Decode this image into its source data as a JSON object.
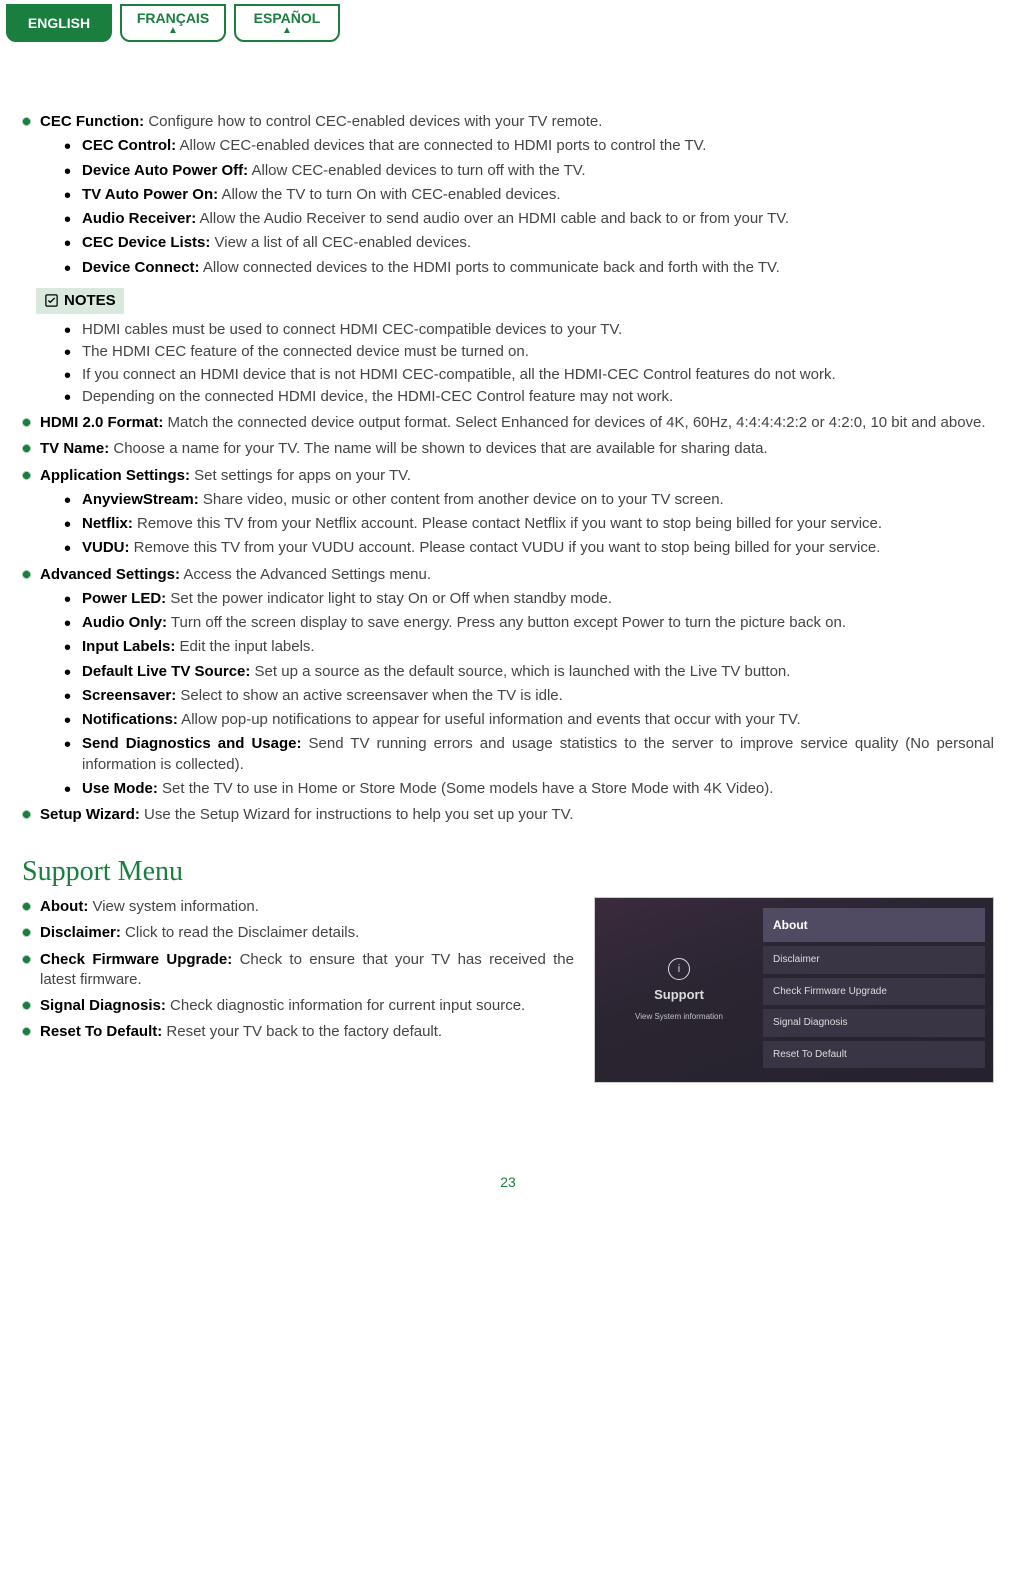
{
  "tabs": {
    "english": "ENGLISH",
    "francais": "FRANÇAIS",
    "espanol": "ESPAÑOL"
  },
  "sections": {
    "cec": {
      "title": "CEC Function:",
      "desc": " Configure how to control CEC-enabled devices with your TV remote.",
      "sub": [
        {
          "t": "CEC Control:",
          "d": " Allow CEC-enabled devices that are connected to HDMI ports to control the TV."
        },
        {
          "t": "Device Auto Power Off:",
          "d": " Allow CEC-enabled devices to turn off with the TV."
        },
        {
          "t": "TV Auto Power On:",
          "d": " Allow the TV to turn On with CEC-enabled devices."
        },
        {
          "t": "Audio Receiver:",
          "d": " Allow the Audio Receiver to send audio over an HDMI cable and back to or from your TV."
        },
        {
          "t": "CEC Device Lists:",
          "d": " View a list of all CEC-enabled devices."
        },
        {
          "t": "Device Connect:",
          "d": " Allow connected devices to the HDMI ports to communicate back and forth with the TV."
        }
      ]
    },
    "notes_label": "NOTES",
    "notes": [
      "HDMI cables must be used to connect HDMI CEC-compatible devices to your TV.",
      "The HDMI CEC feature of the connected device must be turned on.",
      "If you connect an HDMI device that is not HDMI CEC-compatible, all the HDMI-CEC Control features do not work.",
      "Depending on the connected HDMI device, the HDMI-CEC Control feature may not work."
    ],
    "hdmi20": {
      "title": "HDMI 2.0 Format:",
      "desc": " Match the connected device output format. Select Enhanced for devices of 4K, 60Hz, 4:4:4:4:2:2 or 4:2:0, 10 bit and above."
    },
    "tvname": {
      "title": "TV Name:",
      "desc": " Choose a name for your TV. The name will be shown to devices that are available for sharing data."
    },
    "apps": {
      "title": "Application Settings:",
      "desc": " Set settings for apps on your TV.",
      "sub": [
        {
          "t": "AnyviewStream:",
          "d": " Share video, music or other content from another device on to your TV screen."
        },
        {
          "t": "Netflix:",
          "d": " Remove this TV from your Netflix account. Please contact Netflix if you want to stop being billed for your service."
        },
        {
          "t": "VUDU:",
          "d": " Remove this TV from your VUDU account. Please contact VUDU if you want to stop being billed for your service."
        }
      ]
    },
    "adv": {
      "title": "Advanced Settings:",
      "desc": " Access the Advanced Settings menu.",
      "sub": [
        {
          "t": "Power LED:",
          "d": " Set the power indicator light to stay On or Off when standby mode."
        },
        {
          "t": "Audio Only:",
          "d": " Turn off the screen display to save energy. Press any button except Power to turn the picture back on."
        },
        {
          "t": "Input Labels:",
          "d": " Edit the input labels."
        },
        {
          "t": "Default Live TV Source:",
          "d": " Set up a source as the default source, which is launched with the Live TV button."
        },
        {
          "t": "Screensaver:",
          "d": " Select to show an active screensaver when the TV is idle."
        },
        {
          "t": "Notifications:",
          "d": " Allow pop-up notifications to appear for useful information and events that occur with your TV."
        },
        {
          "t": "Send Diagnostics and Usage:",
          "d": " Send TV running errors and usage statistics to the server to improve service quality (No personal information is collected)."
        },
        {
          "t": "Use Mode:",
          "d": " Set the TV to use in Home or Store Mode (Some models have a Store Mode with 4K Video)."
        }
      ]
    },
    "wizard": {
      "title": "Setup Wizard:",
      "desc": " Use the Setup Wizard for instructions to help you set up your TV."
    }
  },
  "support": {
    "heading": "Support Menu",
    "items": [
      {
        "t": "About:",
        "d": " View system information."
      },
      {
        "t": "Disclaimer:",
        "d": " Click to read the Disclaimer details."
      },
      {
        "t": "Check Firmware Upgrade:",
        "d": " Check to ensure that your TV has received the latest firmware."
      },
      {
        "t": "Signal Diagnosis:",
        "d": " Check diagnostic information for current input source."
      },
      {
        "t": "Reset To Default:",
        "d": " Reset your TV back to the factory default."
      }
    ],
    "shot": {
      "left_title": "Support",
      "left_sub": "View System information",
      "rows": [
        "About",
        "Disclaimer",
        "Check Firmware Upgrade",
        "Signal Diagnosis",
        "Reset To Default"
      ]
    }
  },
  "page_number": "23"
}
